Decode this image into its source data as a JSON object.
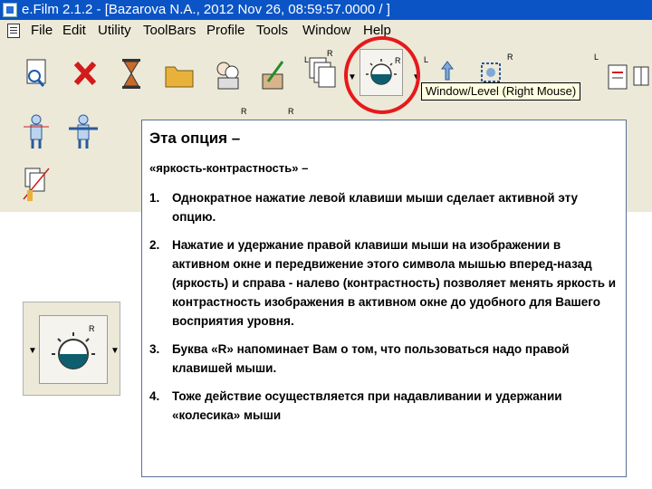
{
  "window": {
    "title": "e.Film 2.1.2 - [Bazarova N.A., 2012 Nov 26, 08:59:57.0000  /  ]"
  },
  "menubar": {
    "items": [
      {
        "label": "File"
      },
      {
        "label": "Edit"
      },
      {
        "label": "Utility"
      },
      {
        "label": "ToolBars"
      },
      {
        "label": "Profile"
      },
      {
        "label": "Tools"
      },
      {
        "label": "Window"
      },
      {
        "label": "Help"
      }
    ]
  },
  "toolbar": {
    "r_label": "R",
    "l_label": "L"
  },
  "tooltip": {
    "text": "Window/Level (Right Mouse)"
  },
  "popup": {
    "title": "Эта опция –",
    "subtitle": "«яркость-контрастность» –",
    "items": [
      {
        "num": "1.",
        "text": "Однократное нажатие левой клавиши мыши сделает активной эту опцию."
      },
      {
        "num": "2.",
        "text": "Нажатие и удержание правой клавиши мыши на изображении в активном окне и передвижение этого символа мышью вперед-назад (яркость) и справа - налево (контрастность) позволяет менять яркость и контрастность изображения в активном окне до удобного для Вашего восприятия уровня."
      },
      {
        "num": "3.",
        "text": "Буква «R» напоминает Вам о том, что пользоваться надо правой клавишей мыши."
      },
      {
        "num": "4.",
        "text": "Тоже действие осуществляется при надавливании и удержании «колесика» мыши"
      }
    ]
  },
  "colors": {
    "titlebar": "#0a54c6",
    "chrome": "#ece9d8",
    "highlight_circle": "#e6191b",
    "tooltip_bg": "#ffffe1"
  }
}
